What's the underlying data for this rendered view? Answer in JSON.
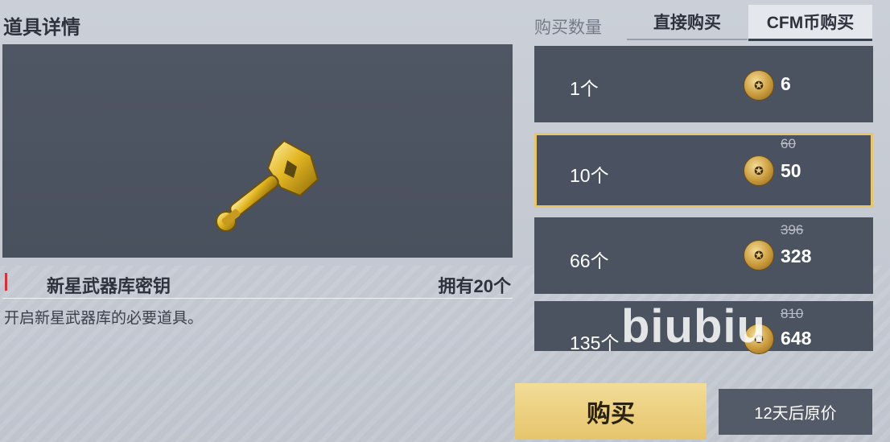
{
  "page_title": "道具详情",
  "item": {
    "name": "新星武器库密钥",
    "owned": "拥有20个",
    "description": "开启新星武器库的必要道具。",
    "icon": "gold-key-icon"
  },
  "purchase": {
    "qty_label": "购买数量",
    "tabs": [
      {
        "label": "直接购买",
        "active": false
      },
      {
        "label": "CFM币购买",
        "active": true
      }
    ],
    "options": [
      {
        "qty": "1个",
        "price": "6",
        "old_price": "",
        "selected": false
      },
      {
        "qty": "10个",
        "price": "50",
        "old_price": "60",
        "selected": true
      },
      {
        "qty": "66个",
        "price": "328",
        "old_price": "396",
        "selected": false
      },
      {
        "qty": "135个",
        "price": "648",
        "old_price": "810",
        "selected": false
      }
    ],
    "coin_icon": "cfm-coin-icon",
    "buy_label": "购买",
    "restore_label": "12天后原价"
  },
  "watermark": "biubiu",
  "colors": {
    "accent_gold": "#e8c46a",
    "panel": "#4b5260",
    "alert_red": "#d2323a"
  }
}
